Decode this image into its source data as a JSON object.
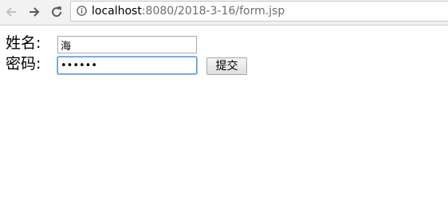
{
  "browser": {
    "url_host": "localhost",
    "url_path": ":8080/2018-3-16/form.jsp",
    "icons": {
      "back": "back-arrow-icon",
      "forward": "forward-arrow-icon",
      "reload": "reload-icon",
      "site_info": "info-icon"
    }
  },
  "form": {
    "name_label": "姓名:",
    "name_value": "海",
    "password_label": "密码:",
    "password_value": "123456",
    "submit_label": "提交"
  },
  "colors": {
    "focus_border": "#5b9dd9",
    "toolbar_bg": "#f2f2f2"
  }
}
